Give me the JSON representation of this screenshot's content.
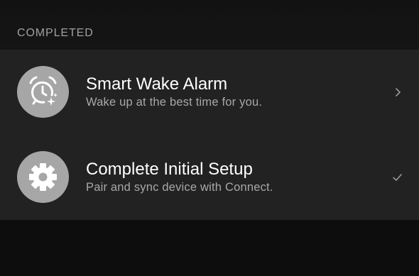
{
  "section": {
    "header": "COMPLETED"
  },
  "items": [
    {
      "title": "Smart Wake Alarm",
      "subtitle": "Wake up at the best time for you.",
      "icon": "alarm-clock-sparkle-icon",
      "trailing_icon": "chevron-right-icon"
    },
    {
      "title": "Complete Initial Setup",
      "subtitle": "Pair and sync device with Connect.",
      "icon": "gear-icon",
      "trailing_icon": "checkmark-icon"
    }
  ],
  "colors": {
    "background": "#0d0d0d",
    "card": "#222222",
    "icon_circle": "#a6a6a6",
    "header_text": "#a0a0a0",
    "subtitle_text": "#a8a8a8"
  }
}
